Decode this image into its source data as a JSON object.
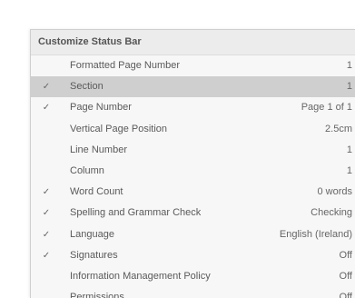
{
  "menu": {
    "title": "Customize Status Bar",
    "check_glyph": "✓",
    "items": [
      {
        "label": "Formatted Page Number",
        "value": "1",
        "checked": false,
        "selected": false
      },
      {
        "label": "Section",
        "value": "1",
        "checked": true,
        "selected": true
      },
      {
        "label": "Page Number",
        "value": "Page 1 of 1",
        "checked": true,
        "selected": false
      },
      {
        "label": "Vertical Page Position",
        "value": "2.5cm",
        "checked": false,
        "selected": false
      },
      {
        "label": "Line Number",
        "value": "1",
        "checked": false,
        "selected": false
      },
      {
        "label": "Column",
        "value": "1",
        "checked": false,
        "selected": false
      },
      {
        "label": "Word Count",
        "value": "0 words",
        "checked": true,
        "selected": false
      },
      {
        "label": "Spelling and Grammar Check",
        "value": "Checking",
        "checked": true,
        "selected": false
      },
      {
        "label": "Language",
        "value": "English (Ireland)",
        "checked": true,
        "selected": false
      },
      {
        "label": "Signatures",
        "value": "Off",
        "checked": true,
        "selected": false
      },
      {
        "label": "Information Management Policy",
        "value": "Off",
        "checked": false,
        "selected": false
      },
      {
        "label": "Permissions",
        "value": "Off",
        "checked": false,
        "selected": false
      }
    ]
  }
}
